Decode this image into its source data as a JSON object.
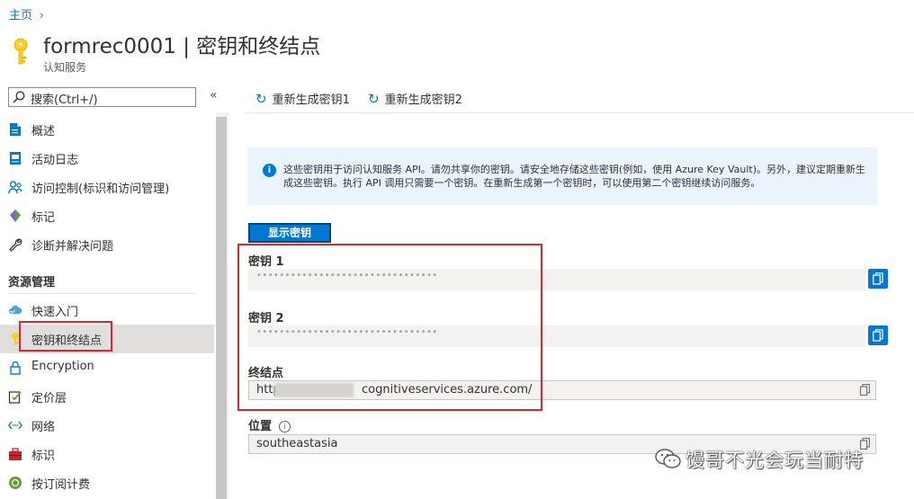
{
  "breadcrumb": {
    "home": "主页",
    "separator": "›"
  },
  "header": {
    "title": "formrec0001 | 密钥和终结点",
    "subtitle": "认知服务"
  },
  "sidebar": {
    "search_placeholder": "搜索(Ctrl+/)",
    "collapse_glyph": "«",
    "items": [
      {
        "label": "概述",
        "icon": "overview-icon"
      },
      {
        "label": "活动日志",
        "icon": "activity-log-icon"
      },
      {
        "label": "访问控制(标识和访问管理)",
        "icon": "access-control-icon"
      },
      {
        "label": "标记",
        "icon": "tag-icon"
      },
      {
        "label": "诊断并解决问题",
        "icon": "wrench-icon"
      }
    ],
    "section_title": "资源管理",
    "section_items": [
      {
        "label": "快速入门",
        "icon": "cloud-icon"
      },
      {
        "label": "密钥和终结点",
        "icon": "key-icon",
        "selected": true
      },
      {
        "label": "Encryption",
        "icon": "lock-icon"
      },
      {
        "label": "定价层",
        "icon": "pricing-icon"
      },
      {
        "label": "网络",
        "icon": "network-icon"
      },
      {
        "label": "标识",
        "icon": "identity-icon"
      },
      {
        "label": "按订阅计费",
        "icon": "billing-icon"
      }
    ]
  },
  "toolbar": {
    "regen_key1": "重新生成密钥1",
    "regen_key2": "重新生成密钥2"
  },
  "info": {
    "text": "这些密钥用于访问认知服务 API。请勿共享你的密钥。请安全地存储这些密钥(例如，使用 Azure Key Vault)。另外，建议定期重新生成这些密钥。执行 API 调用只需要一个密钥。在重新生成第一个密钥时，可以使用第二个密钥继续访问服务。"
  },
  "show_keys_button": "显示密钥",
  "fields": {
    "key1_label": "密钥 1",
    "key1_value": "••••••••••••••••••••••••••••••••",
    "key2_label": "密钥 2",
    "key2_value": "••••••••••••••••••••••••••••••••",
    "endpoint_label": "终结点",
    "endpoint_prefix": "http",
    "endpoint_suffix": "cognitiveservices.azure.com/",
    "location_label": "位置",
    "location_value": "southeastasia"
  },
  "watermark": {
    "text": "馒哥不光会玩当耐特"
  },
  "colors": {
    "accent": "#0078d4",
    "annotation": "#e0242b",
    "selected_bg": "#e1dfdd"
  }
}
